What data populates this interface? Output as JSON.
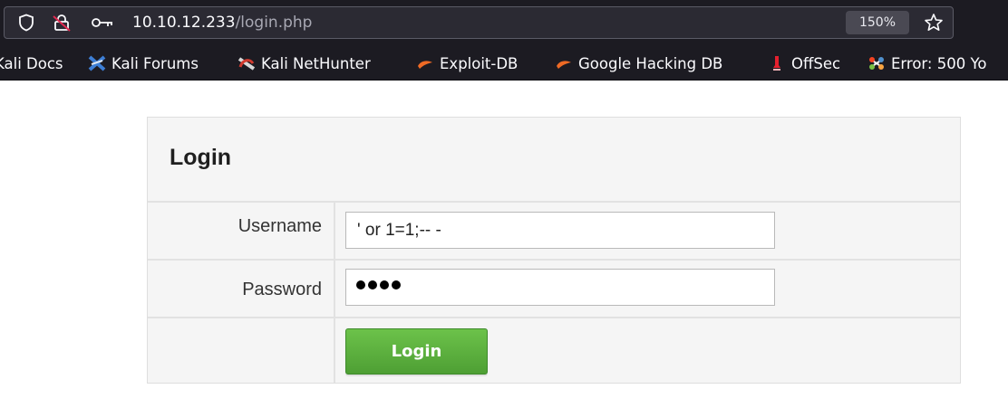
{
  "browser": {
    "url_host": "10.10.12.233",
    "url_path": "/login.php",
    "zoom": "150%",
    "icons": [
      "shield-icon",
      "lock-insecure-icon",
      "key-icon",
      "star-bookmark-icon"
    ],
    "bookmarks": [
      {
        "label": "Kali Docs",
        "icon": "kali-icon"
      },
      {
        "label": "Kali Forums",
        "icon": "kali-forums-icon"
      },
      {
        "label": "Kali NetHunter",
        "icon": "nethunter-icon"
      },
      {
        "label": "Exploit-DB",
        "icon": "exploit-db-icon"
      },
      {
        "label": "Google Hacking DB",
        "icon": "ghdb-icon"
      },
      {
        "label": "OffSec",
        "icon": "offsec-icon"
      },
      {
        "label": "Error: 500 Yo",
        "icon": "joomla-icon"
      }
    ]
  },
  "login": {
    "title": "Login",
    "username_label": "Username",
    "username_value": "' or 1=1;-- -",
    "password_label": "Password",
    "password_masked": "●●●●",
    "submit_label": "Login",
    "accent_color": "#5cb13e"
  }
}
